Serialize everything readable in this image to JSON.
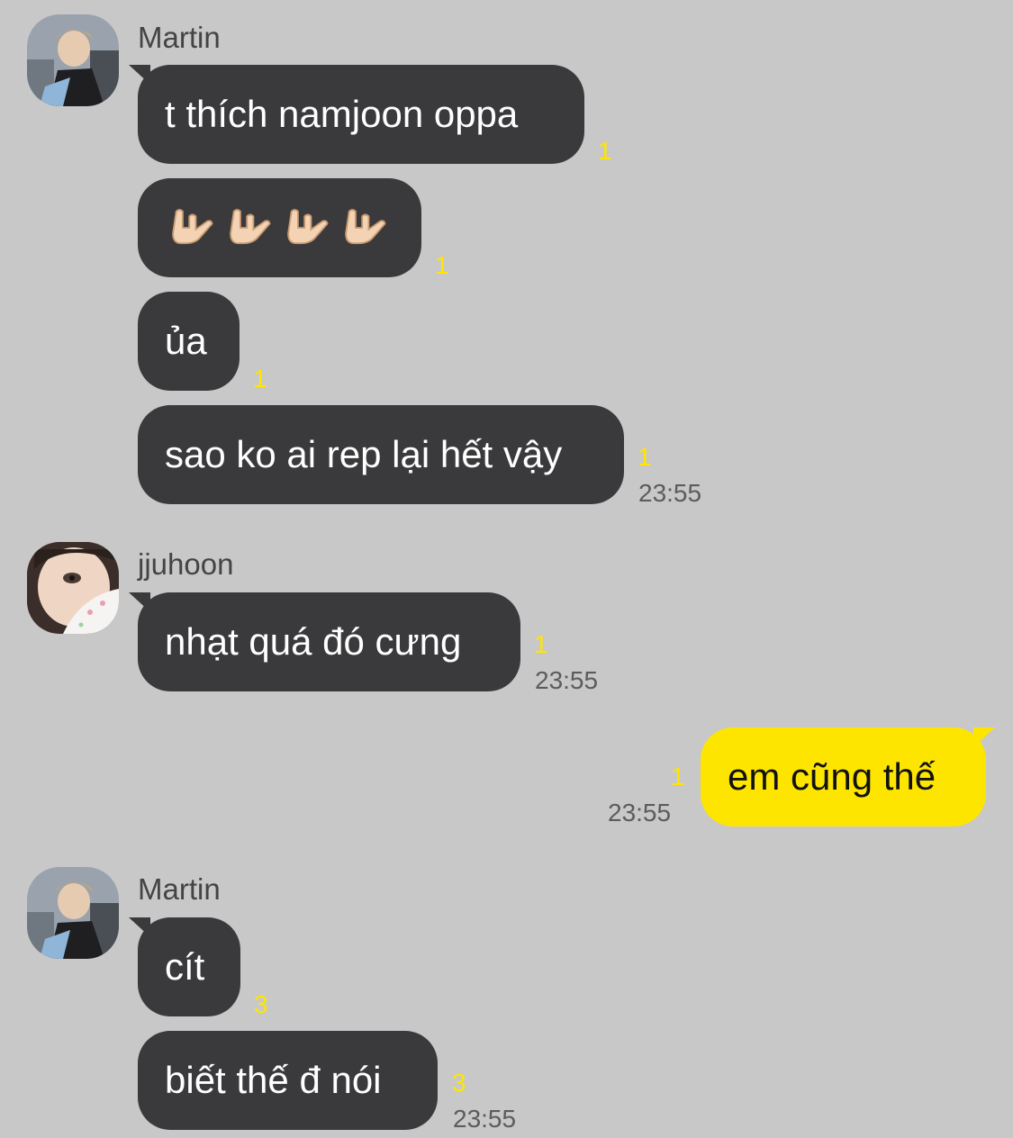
{
  "messages": [
    {
      "sender": "Martin",
      "text": "t thích namjoon oppa",
      "unread": "1"
    },
    {
      "emoji": "sign-of-the-horns",
      "count": 4,
      "unread": "1"
    },
    {
      "text": "ủa",
      "unread": "1"
    },
    {
      "text": "sao ko ai rep lại hết vậy",
      "unread": "1",
      "time": "23:55"
    },
    {
      "sender": "jjuhoon",
      "text": "nhạt quá đó cưng",
      "unread": "1",
      "time": "23:55"
    },
    {
      "outgoing": true,
      "text": "em cũng thế",
      "unread": "1",
      "time": "23:55"
    },
    {
      "sender": "Martin",
      "text": "cít",
      "unread": "3"
    },
    {
      "text": "biết thế đ nói",
      "unread": "3",
      "time": "23:55"
    }
  ],
  "colors": {
    "background": "#c8c8c8",
    "incoming_bubble": "#3a3a3c",
    "outgoing_bubble": "#fee500",
    "unread_count": "#ffe500",
    "timestamp": "#5c5c5c"
  }
}
